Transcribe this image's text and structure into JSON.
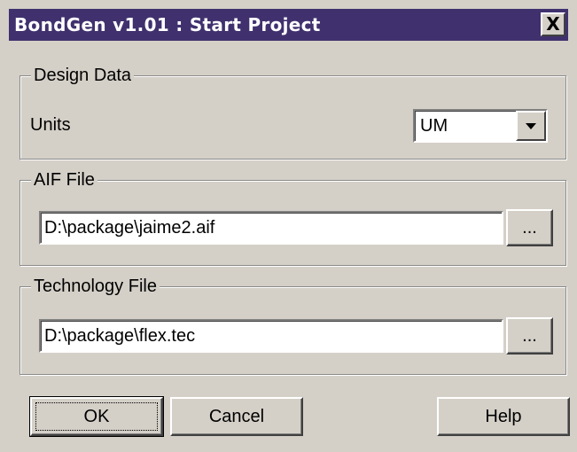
{
  "dialog": {
    "title": "BondGen v1.01 : Start Project",
    "close_label": "X"
  },
  "design_data": {
    "group_label": "Design Data",
    "units_label": "Units",
    "units_value": "UM"
  },
  "aif_file": {
    "group_label": "AIF File",
    "path": "D:\\package\\jaime2.aif",
    "browse_label": "..."
  },
  "technology_file": {
    "group_label": "Technology File",
    "path": "D:\\package\\flex.tec",
    "browse_label": "..."
  },
  "buttons": {
    "ok": "OK",
    "cancel": "Cancel",
    "help": "Help"
  },
  "icons": {
    "close": "close-icon",
    "dropdown": "chevron-down-icon"
  }
}
